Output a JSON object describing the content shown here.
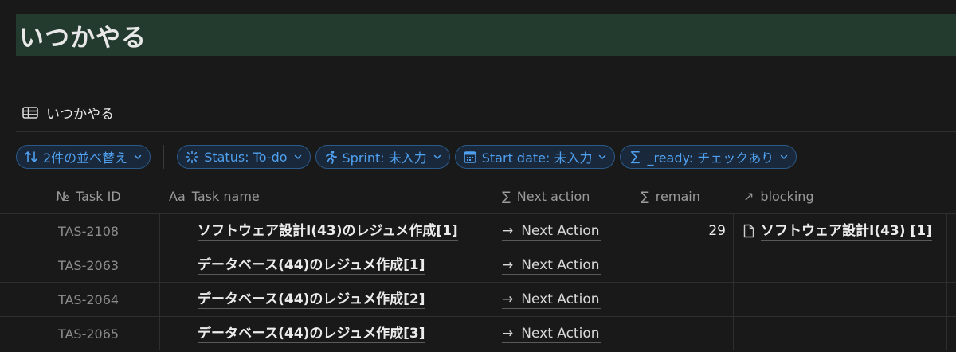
{
  "page": {
    "title": "いつかやる"
  },
  "view": {
    "name": "いつかやる",
    "icon": "table-icon"
  },
  "filters": [
    {
      "label": "2件の並べ替え",
      "icon": "sort-icon"
    },
    {
      "label": "Status: To-do",
      "icon": "status-spinner-icon"
    },
    {
      "label": "Sprint: 未入力",
      "icon": "running-person-icon"
    },
    {
      "label": "Start date: 未入力",
      "icon": "calendar-icon"
    },
    {
      "label": "_ready: チェックあり",
      "icon": "sigma-icon"
    }
  ],
  "columns": {
    "task_id": {
      "icon_text": "№",
      "label": "Task ID"
    },
    "task_name": {
      "icon_text": "Aa",
      "label": "Task name"
    },
    "next_action": {
      "icon_text": "∑",
      "label": "Next action"
    },
    "remain": {
      "icon_text": "∑",
      "label": "remain"
    },
    "blocking": {
      "icon_text": "↗",
      "label": "blocking"
    }
  },
  "rows": [
    {
      "id": "TAS-2108",
      "name": "ソフトウェア設計I(43)のレジュメ作成[1]",
      "next_action": "Next Action",
      "remain": "29",
      "blocking": "ソフトウェア設計I(43) [1]"
    },
    {
      "id": "TAS-2063",
      "name": "データベース(44)のレジュメ作成[1]",
      "next_action": "Next Action",
      "remain": "",
      "blocking": ""
    },
    {
      "id": "TAS-2064",
      "name": "データベース(44)のレジュメ作成[2]",
      "next_action": "Next Action",
      "remain": "",
      "blocking": ""
    },
    {
      "id": "TAS-2065",
      "name": "データベース(44)のレジュメ作成[3]",
      "next_action": "Next Action",
      "remain": "",
      "blocking": ""
    }
  ],
  "colors": {
    "accent": "#4fa0ef",
    "title_band": "#233a2e",
    "background": "#191919"
  }
}
